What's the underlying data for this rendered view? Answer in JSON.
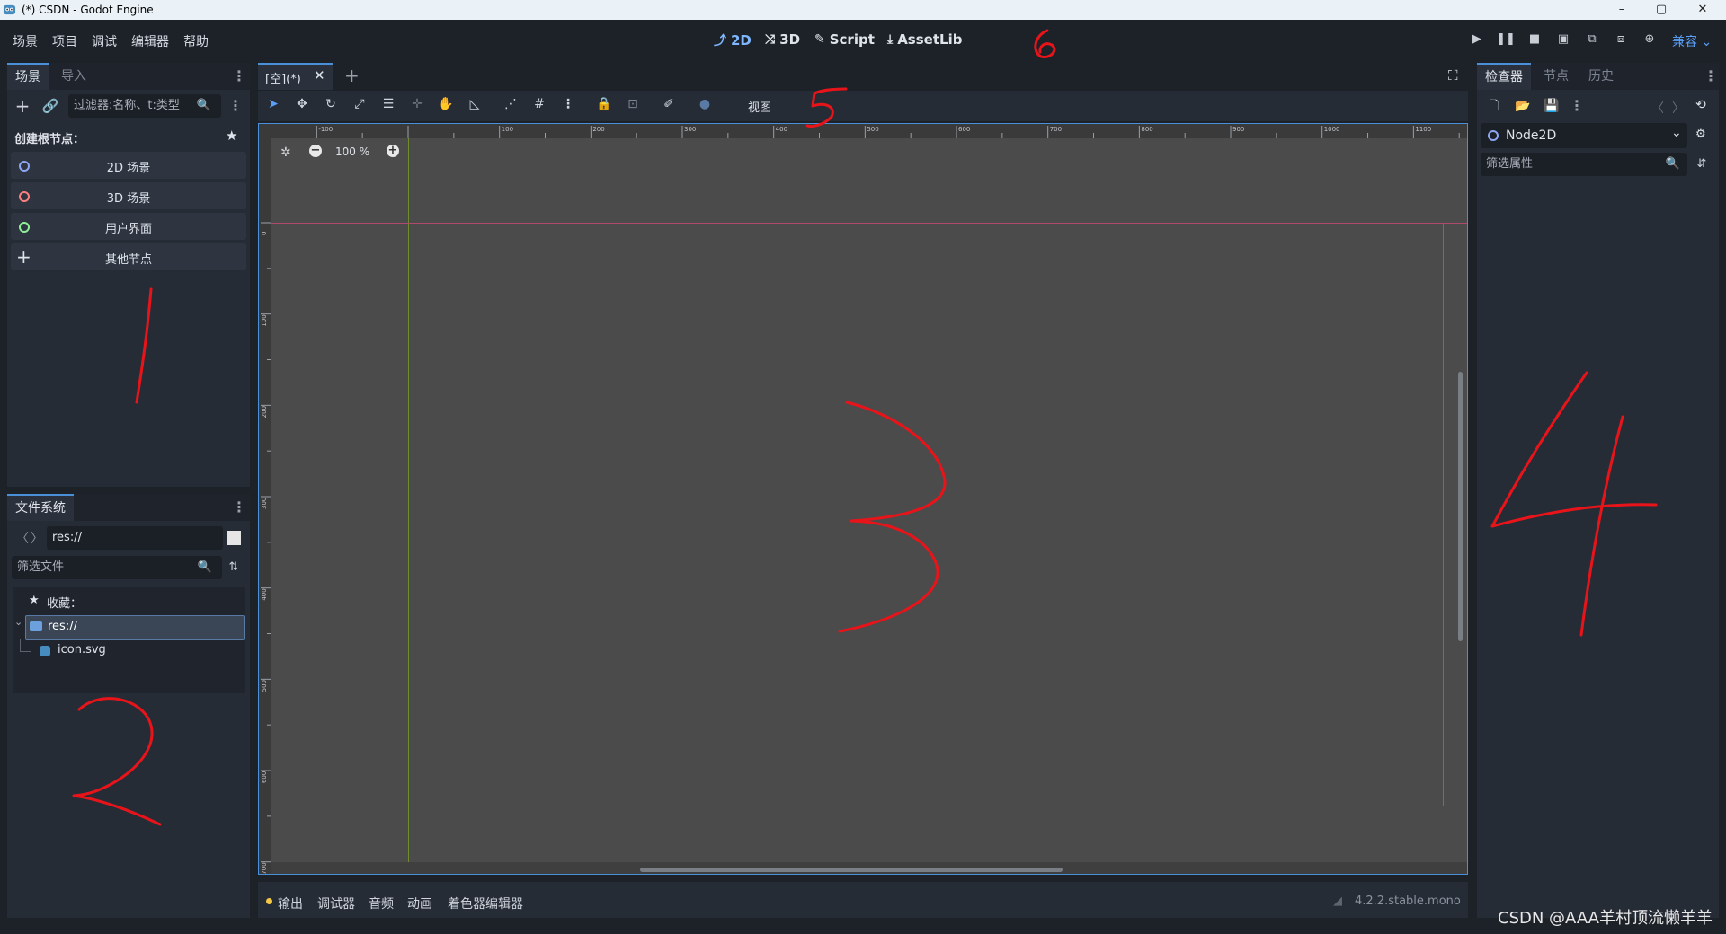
{
  "window": {
    "title": "(*) CSDN - Godot Engine",
    "min": "–",
    "max": "▢",
    "close": "✕"
  },
  "menu": [
    "场景",
    "项目",
    "调试",
    "编辑器",
    "帮助"
  ],
  "workspaces": [
    {
      "label": "2D",
      "icon": "⤴"
    },
    {
      "label": "3D",
      "icon": "⤨"
    },
    {
      "label": "Script",
      "icon": "✎"
    },
    {
      "label": "AssetLib",
      "icon": "⤓"
    }
  ],
  "play_controls": [
    "▶",
    "❚❚",
    "■",
    "▣",
    "⧉",
    "⧈",
    "⊕"
  ],
  "renderer": "兼容",
  "scene_dock": {
    "tabs": [
      "场景",
      "导入"
    ],
    "filter_placeholder": "过滤器:名称、t:类型",
    "create_root_label": "创建根节点：",
    "nodes": [
      {
        "label": "2D 场景",
        "color": "#8da5f3"
      },
      {
        "label": "3D 场景",
        "color": "#fc7f7f"
      },
      {
        "label": "用户界面",
        "color": "#8eef97"
      },
      {
        "label": "其他节点",
        "color": ""
      }
    ]
  },
  "filesystem": {
    "title": "文件系统",
    "path": "res://",
    "filter_placeholder": "筛选文件",
    "favorites": "收藏：",
    "root": "res://",
    "files": [
      "icon.svg"
    ]
  },
  "editor": {
    "scene_tab": "[空](*)",
    "view_menu": "视图",
    "zoom": "100 %",
    "ruler_labels": [
      "-100",
      "100",
      "200",
      "300",
      "400",
      "500",
      "600",
      "700",
      "800",
      "900",
      "1000",
      "1100"
    ],
    "vruler_labels": [
      "0",
      "100",
      "200",
      "300",
      "400",
      "500",
      "600",
      "700"
    ]
  },
  "bottom_panel": {
    "items": [
      "输出",
      "调试器",
      "音频",
      "动画",
      "着色器编辑器"
    ],
    "version": "4.2.2.stable.mono"
  },
  "inspector": {
    "tabs": [
      "检查器",
      "节点",
      "历史"
    ],
    "node": "Node2D",
    "filter_placeholder": "筛选属性"
  },
  "annotations": [
    "1",
    "2",
    "3",
    "4",
    "5",
    "6"
  ],
  "watermark": "CSDN @AAA羊村顶流懒羊羊",
  "colors": {
    "accent": "#4a90d9",
    "annotation": "#e8141a",
    "viewport": "#4b4b4b"
  }
}
